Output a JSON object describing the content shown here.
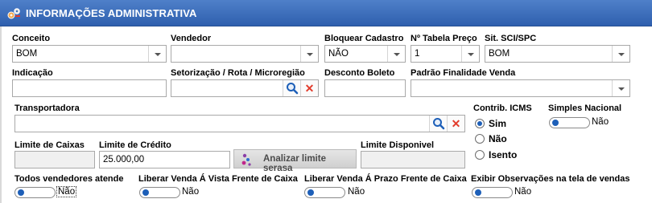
{
  "header": {
    "title": "INFORMAÇÕES ADMINISTRATIVA",
    "icon": "config-gears-icon",
    "color": "#3b6db8"
  },
  "fields": {
    "conceito": {
      "label": "Conceito",
      "value": "BOM"
    },
    "vendedor": {
      "label": "Vendedor",
      "value": ""
    },
    "bloquear_cadastro": {
      "label": "Bloquear Cadastro",
      "value": "NÃO"
    },
    "tabela_preco": {
      "label": "Nº Tabela Preço",
      "value": "1"
    },
    "sit_sci_spc": {
      "label": "Sit. SCI/SPC",
      "value": "BOM"
    },
    "indicacao": {
      "label": "Indicação",
      "value": ""
    },
    "setorizacao": {
      "label": "Setorização / Rota / Microregião",
      "value": ""
    },
    "desconto_boleto": {
      "label": "Desconto Boleto",
      "value": ""
    },
    "padrao_finalidade": {
      "label": "Padrão Finalidade Venda",
      "value": ""
    },
    "transportadora": {
      "label": "Transportadora",
      "value": ""
    },
    "limite_caixas": {
      "label": "Limite de Caixas",
      "value": ""
    },
    "limite_credito": {
      "label": "Limite de Crédito",
      "value": "25.000,00"
    },
    "limite_disponivel": {
      "label": "Limite Disponivel",
      "value": ""
    }
  },
  "buttons": {
    "analisar_serasa": "Analizar limite serasa"
  },
  "contrib_icms": {
    "label": "Contrib. ICMS",
    "options": [
      "Sim",
      "Não",
      "Isento"
    ],
    "selected": "Sim"
  },
  "toggles": {
    "simples_nacional": {
      "label": "Simples Nacional",
      "state": "Não"
    },
    "todos_vendedores": {
      "label": "Todos vendedores atende",
      "state": "Não"
    },
    "liberar_vista": {
      "label": "Liberar Venda Á Vista Frente de Caixa",
      "state": "Não"
    },
    "liberar_prazo": {
      "label": "Liberar Venda Á Prazo Frente de Caixa",
      "state": "Não"
    },
    "exibir_observacoes": {
      "label": "Exibir Observações na tela de vendas",
      "state": "Não"
    }
  },
  "colors": {
    "accent": "#1d5fb8",
    "delete": "#e23b2b"
  }
}
